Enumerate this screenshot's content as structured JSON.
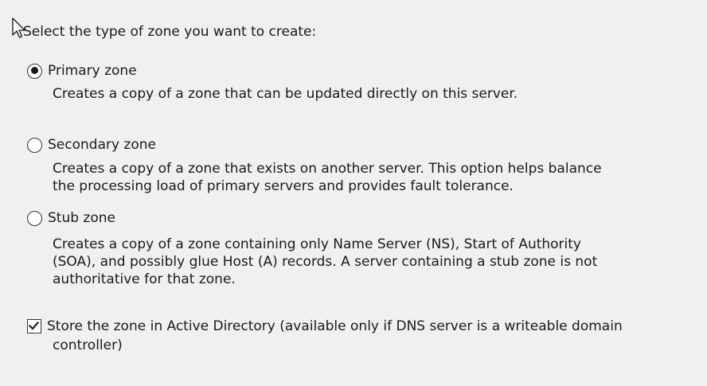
{
  "heading": "Select the type of zone you want to create:",
  "zone_types": [
    {
      "label": "Primary zone",
      "selected": true,
      "description_lines": [
        "Creates a copy of a zone that can be updated directly on this server."
      ]
    },
    {
      "label": "Secondary zone",
      "selected": false,
      "description_lines": [
        "Creates a copy of a zone that exists on another server. This option helps balance",
        "the processing load of primary servers and provides fault tolerance."
      ]
    },
    {
      "label": "Stub zone",
      "selected": false,
      "description_lines": [
        "Creates a copy of a zone containing only Name Server (NS), Start of Authority",
        "(SOA), and possibly glue Host (A) records. A server containing a stub zone is not",
        "authoritative for that zone."
      ]
    }
  ],
  "active_directory_option": {
    "label_line1": "Store the zone in Active Directory (available only if DNS server is a writeable domain",
    "label_line2": "controller)",
    "checked": true
  },
  "icons": {
    "cursor": "mouse-pointer-icon",
    "checkmark": "checkmark-icon"
  }
}
